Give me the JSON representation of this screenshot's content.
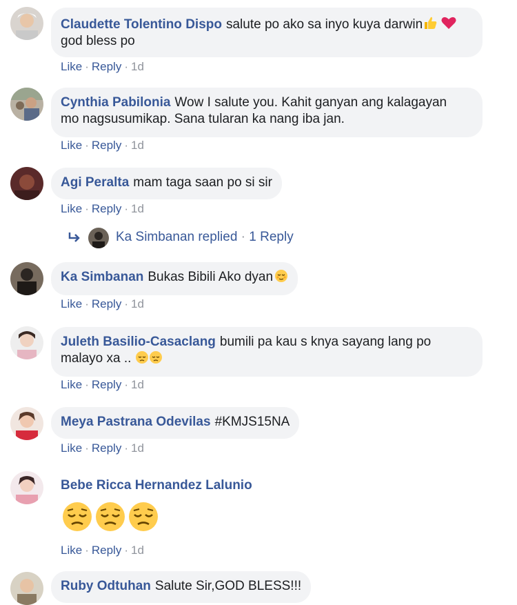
{
  "comments": [
    {
      "author": "Claudette Tolentino Dispo",
      "text1": "salute po ako sa inyo kuya darwin",
      "text2": "god bless po",
      "like": "Like",
      "reply": "Reply",
      "time": "1d",
      "emojis": [
        "thumbs-up",
        "heart"
      ]
    },
    {
      "author": "Cynthia Pabilonia",
      "text1": "Wow I salute you. Kahit ganyan ang kalagayan",
      "text2": "mo nagsusumikap. Sana tularan ka nang iba jan.",
      "like": "Like",
      "reply": "Reply",
      "time": "1d"
    },
    {
      "author": "Agi Peralta",
      "text1": "mam taga saan po si sir",
      "like": "Like",
      "reply": "Reply",
      "time": "1d"
    },
    {
      "author": "Ka Simbanan",
      "text1": "Bukas Bibili Ako dyan",
      "like": "Like",
      "reply": "Reply",
      "time": "1d",
      "emojis": [
        "relieved-face"
      ]
    },
    {
      "author": "Juleth Basilio-Casaclang",
      "text1": "bumili pa kau s knya sayang lang po",
      "text2": "malayo xa ..",
      "like": "Like",
      "reply": "Reply",
      "time": "1d",
      "emojis": [
        "pensive-face",
        "pensive-face"
      ]
    },
    {
      "author": "Meya Pastrana Odevilas",
      "text1": "#KMJS15NA",
      "like": "Like",
      "reply": "Reply",
      "time": "1d"
    },
    {
      "author": "Bebe Ricca Hernandez Lalunio",
      "like": "Like",
      "reply": "Reply",
      "time": "1d",
      "emojis": [
        "pensive-face",
        "pensive-face",
        "pensive-face"
      ]
    },
    {
      "author": "Ruby Odtuhan",
      "text1": "Salute Sir,GOD BLESS!!!"
    }
  ],
  "replies_summary": {
    "name": "Ka Simbanan replied",
    "dot": "·",
    "count": "1 Reply"
  },
  "colors": {
    "link": "#385898",
    "bubble": "#f2f3f5",
    "meta": "#90949c"
  }
}
